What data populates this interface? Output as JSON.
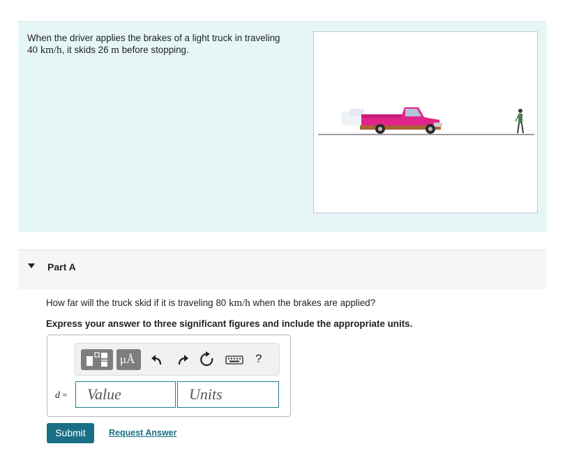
{
  "problem": {
    "line1": "When the driver applies the brakes of a light truck in traveling",
    "speed": "40 km/h",
    "line2_after_speed": ", it skids 26 ",
    "unit_m": "m",
    "line2_end": " before stopping."
  },
  "figure": {
    "truck_color": "#e0248a",
    "icon": "truck-and-person-illustration"
  },
  "part": {
    "title": "Part A",
    "question_before": "How far will the truck skid if it is traveling 80 ",
    "question_unit": "km/h",
    "question_after": " when the brakes are applied?",
    "instruction": "Express your answer to three significant figures and include the appropriate units."
  },
  "answer": {
    "variable": "d",
    "equals": "=",
    "value_placeholder": "Value",
    "units_placeholder": "Units",
    "mu_label": "μÅ",
    "help_label": "?"
  },
  "actions": {
    "submit_label": "Submit",
    "request_label": "Request Answer"
  },
  "colors": {
    "accent": "#1a6f86",
    "panel_bg": "#e6f6f7"
  }
}
